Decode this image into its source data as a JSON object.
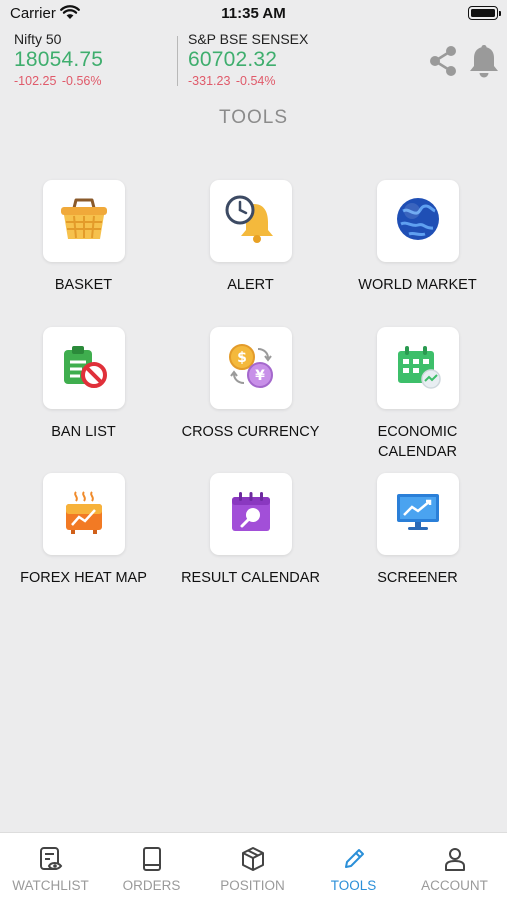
{
  "status_bar": {
    "carrier": "Carrier",
    "time": "11:35 AM"
  },
  "indices": [
    {
      "name": "Nifty 50",
      "value": "18054.75",
      "change": "-102.25",
      "change_pct": "-0.56%"
    },
    {
      "name": "S&P BSE SENSEX",
      "value": "60702.32",
      "change": "-331.23",
      "change_pct": "-0.54%"
    }
  ],
  "colors": {
    "positive": "#3fae6e",
    "negative": "#e05a6a",
    "active_tab": "#2b8fd8",
    "inactive": "#9a9a9a"
  },
  "page_title": "TOOLS",
  "tools": [
    {
      "label": "BASKET",
      "icon": "basket-icon"
    },
    {
      "label": "ALERT",
      "icon": "alert-clock-bell-icon"
    },
    {
      "label": "WORLD MARKET",
      "icon": "globe-icon"
    },
    {
      "label": "BAN LIST",
      "icon": "ban-list-icon"
    },
    {
      "label": "CROSS CURRENCY",
      "icon": "currency-exchange-icon"
    },
    {
      "label": "ECONOMIC CALENDAR",
      "label_line1": "ECONOMIC",
      "label_line2": "CALENDAR",
      "icon": "economic-calendar-icon"
    },
    {
      "label": "FOREX HEAT MAP",
      "icon": "forex-heat-map-icon"
    },
    {
      "label": "RESULT CALENDAR",
      "icon": "result-calendar-icon"
    },
    {
      "label": "SCREENER",
      "icon": "screener-icon"
    }
  ],
  "nav": [
    {
      "label": "WATCHLIST",
      "icon": "watchlist-icon",
      "active": false
    },
    {
      "label": "ORDERS",
      "icon": "book-icon",
      "active": false
    },
    {
      "label": "POSITION",
      "icon": "box-icon",
      "active": false
    },
    {
      "label": "TOOLS",
      "icon": "pencil-icon",
      "active": true
    },
    {
      "label": "ACCOUNT",
      "icon": "user-icon",
      "active": false
    }
  ]
}
